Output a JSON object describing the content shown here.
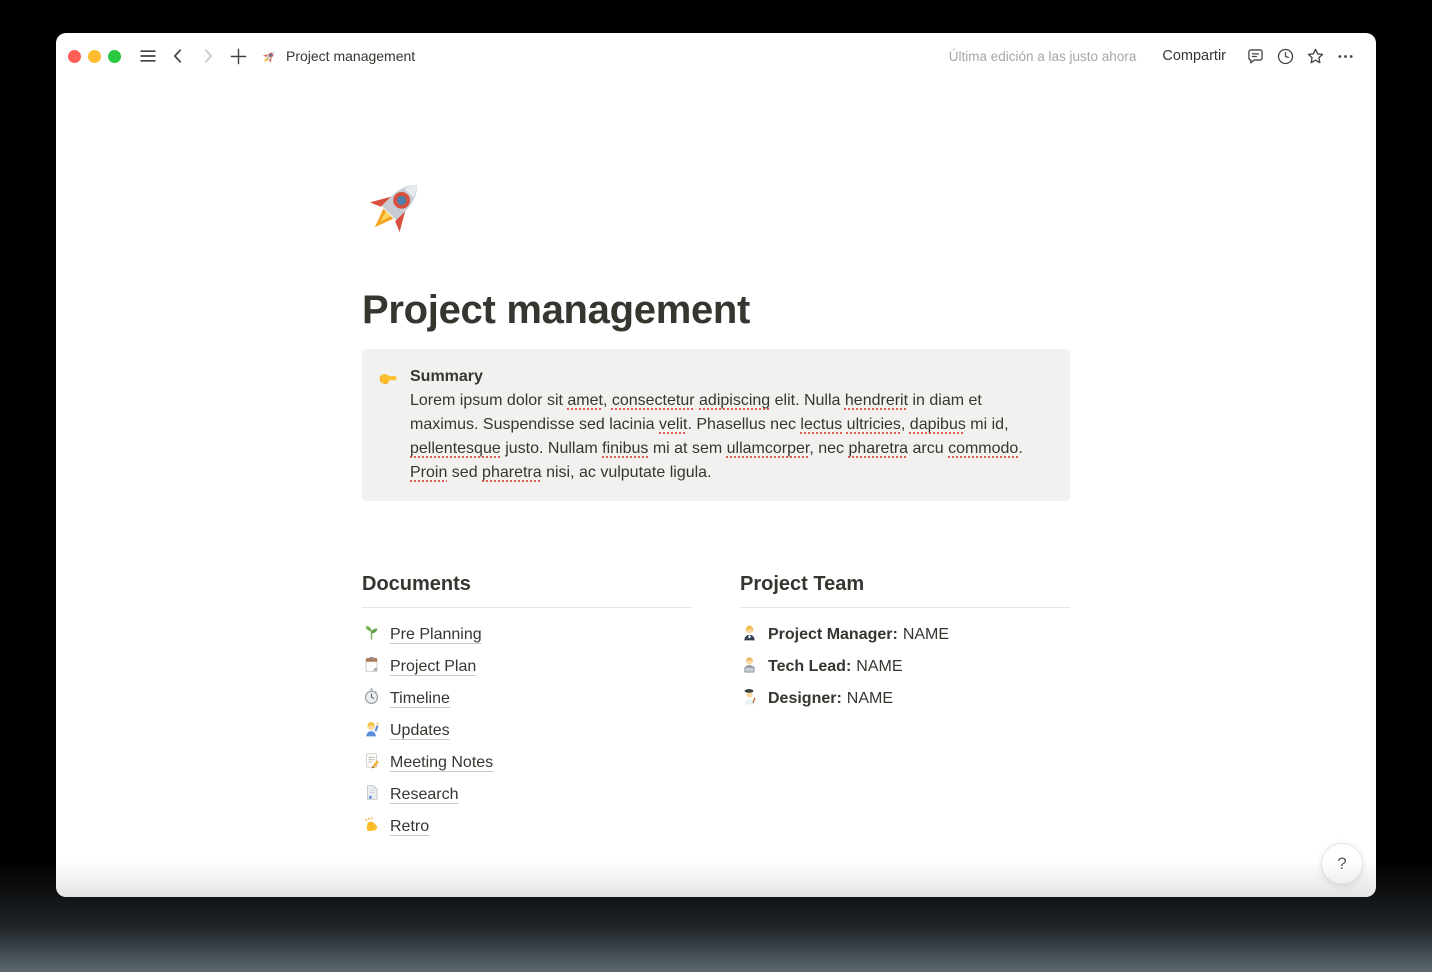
{
  "titlebar": {
    "title": "Project management",
    "title_icon": "🚀",
    "edited_label": "Última edición a las justo ahora",
    "share_label": "Compartir"
  },
  "page": {
    "icon_emoji": "🚀",
    "title": "Project management",
    "callout": {
      "icon_emoji": "👉",
      "title": "Summary",
      "segments": [
        {
          "text": "Lorem ipsum dolor sit "
        },
        {
          "text": "amet",
          "misspelled": true
        },
        {
          "text": ", "
        },
        {
          "text": "consectetur",
          "misspelled": true
        },
        {
          "text": " "
        },
        {
          "text": "adipiscing",
          "misspelled": true
        },
        {
          "text": " elit. Nulla "
        },
        {
          "text": "hendrerit",
          "misspelled": true
        },
        {
          "text": " in diam et maximus. Suspendisse sed lacinia "
        },
        {
          "text": "velit",
          "misspelled": true
        },
        {
          "text": ". Phasellus nec "
        },
        {
          "text": "lectus",
          "misspelled": true
        },
        {
          "text": " "
        },
        {
          "text": "ultricies",
          "misspelled": true
        },
        {
          "text": ", "
        },
        {
          "text": "dapibus",
          "misspelled": true
        },
        {
          "text": " mi id, "
        },
        {
          "text": "pellentesque",
          "misspelled": true
        },
        {
          "text": " justo. Nullam "
        },
        {
          "text": "finibus",
          "misspelled": true
        },
        {
          "text": " mi at sem "
        },
        {
          "text": "ullamcorper",
          "misspelled": true
        },
        {
          "text": ", nec "
        },
        {
          "text": "pharetra",
          "misspelled": true
        },
        {
          "text": " arcu "
        },
        {
          "text": "commodo",
          "misspelled": true
        },
        {
          "text": ". "
        },
        {
          "text": "Proin",
          "misspelled": true
        },
        {
          "text": " sed "
        },
        {
          "text": "pharetra",
          "misspelled": true
        },
        {
          "text": " nisi, ac vulputate ligula."
        }
      ]
    },
    "documents": {
      "heading": "Documents",
      "items": [
        {
          "icon": "seedling",
          "emoji": "🌱",
          "label": "Pre Planning"
        },
        {
          "icon": "clipboard",
          "emoji": "📋",
          "label": "Project Plan"
        },
        {
          "icon": "stopwatch",
          "emoji": "⏱️",
          "label": "Timeline"
        },
        {
          "icon": "woman-raising-hand",
          "emoji": "🙋‍♀️",
          "label": "Updates"
        },
        {
          "icon": "memo",
          "emoji": "📝",
          "label": "Meeting Notes"
        },
        {
          "icon": "bookmark-tabs",
          "emoji": "📑",
          "label": "Research"
        },
        {
          "icon": "clapping-hands",
          "emoji": "👏",
          "label": "Retro"
        }
      ]
    },
    "team": {
      "heading": "Project Team",
      "members": [
        {
          "icon": "woman-office-worker",
          "emoji": "👩‍💼",
          "role": "Project Manager:",
          "name": "NAME"
        },
        {
          "icon": "man-technologist",
          "emoji": "👨‍💻",
          "role": "Tech Lead:",
          "name": "NAME"
        },
        {
          "icon": "man-artist",
          "emoji": "👨‍🎨",
          "role": "Designer:",
          "name": "NAME"
        }
      ]
    },
    "help_label": "?"
  },
  "colors": {
    "text": "#37352f",
    "muted_text": "#a7a6a3",
    "callout_bg": "#f1f1ef",
    "divider": "#e7e6e4",
    "link_underline": "#c9c8c5",
    "spellcheck_red": "#e25a53",
    "traffic_close": "#ff5f57",
    "traffic_minimize": "#febc2e",
    "traffic_zoom": "#28c840",
    "window_bg": "#ffffff",
    "backdrop": "#000000",
    "backdrop_bottom": "#5c6972"
  }
}
